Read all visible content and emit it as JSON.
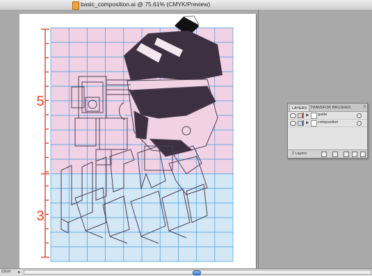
{
  "window": {
    "title": "basic_composition.ai @ 75.61% (CMYK/Preview)"
  },
  "artwork": {
    "section_top_label": "5",
    "section_bottom_label": "3",
    "colors": {
      "top_band": "#f1d1e4",
      "bottom_band": "#d4e7f5",
      "grid": "#3b9be0",
      "line_art": "#4a3f55",
      "dark_fill": "#3d3141",
      "ruler": "#e2452b"
    }
  },
  "layers_panel": {
    "tabs": [
      "LAYERS",
      "TRANSFOR",
      "BRUSHES"
    ],
    "active_tab": "LAYERS",
    "layers": [
      {
        "name": "guide",
        "color": "#e64b3c",
        "icon": "eye-icon"
      },
      {
        "name": "composition",
        "color": "#3a7bd5",
        "icon": "eye-icon"
      }
    ],
    "footer_count": "2 Layers"
  },
  "status": {
    "label": "ction"
  }
}
